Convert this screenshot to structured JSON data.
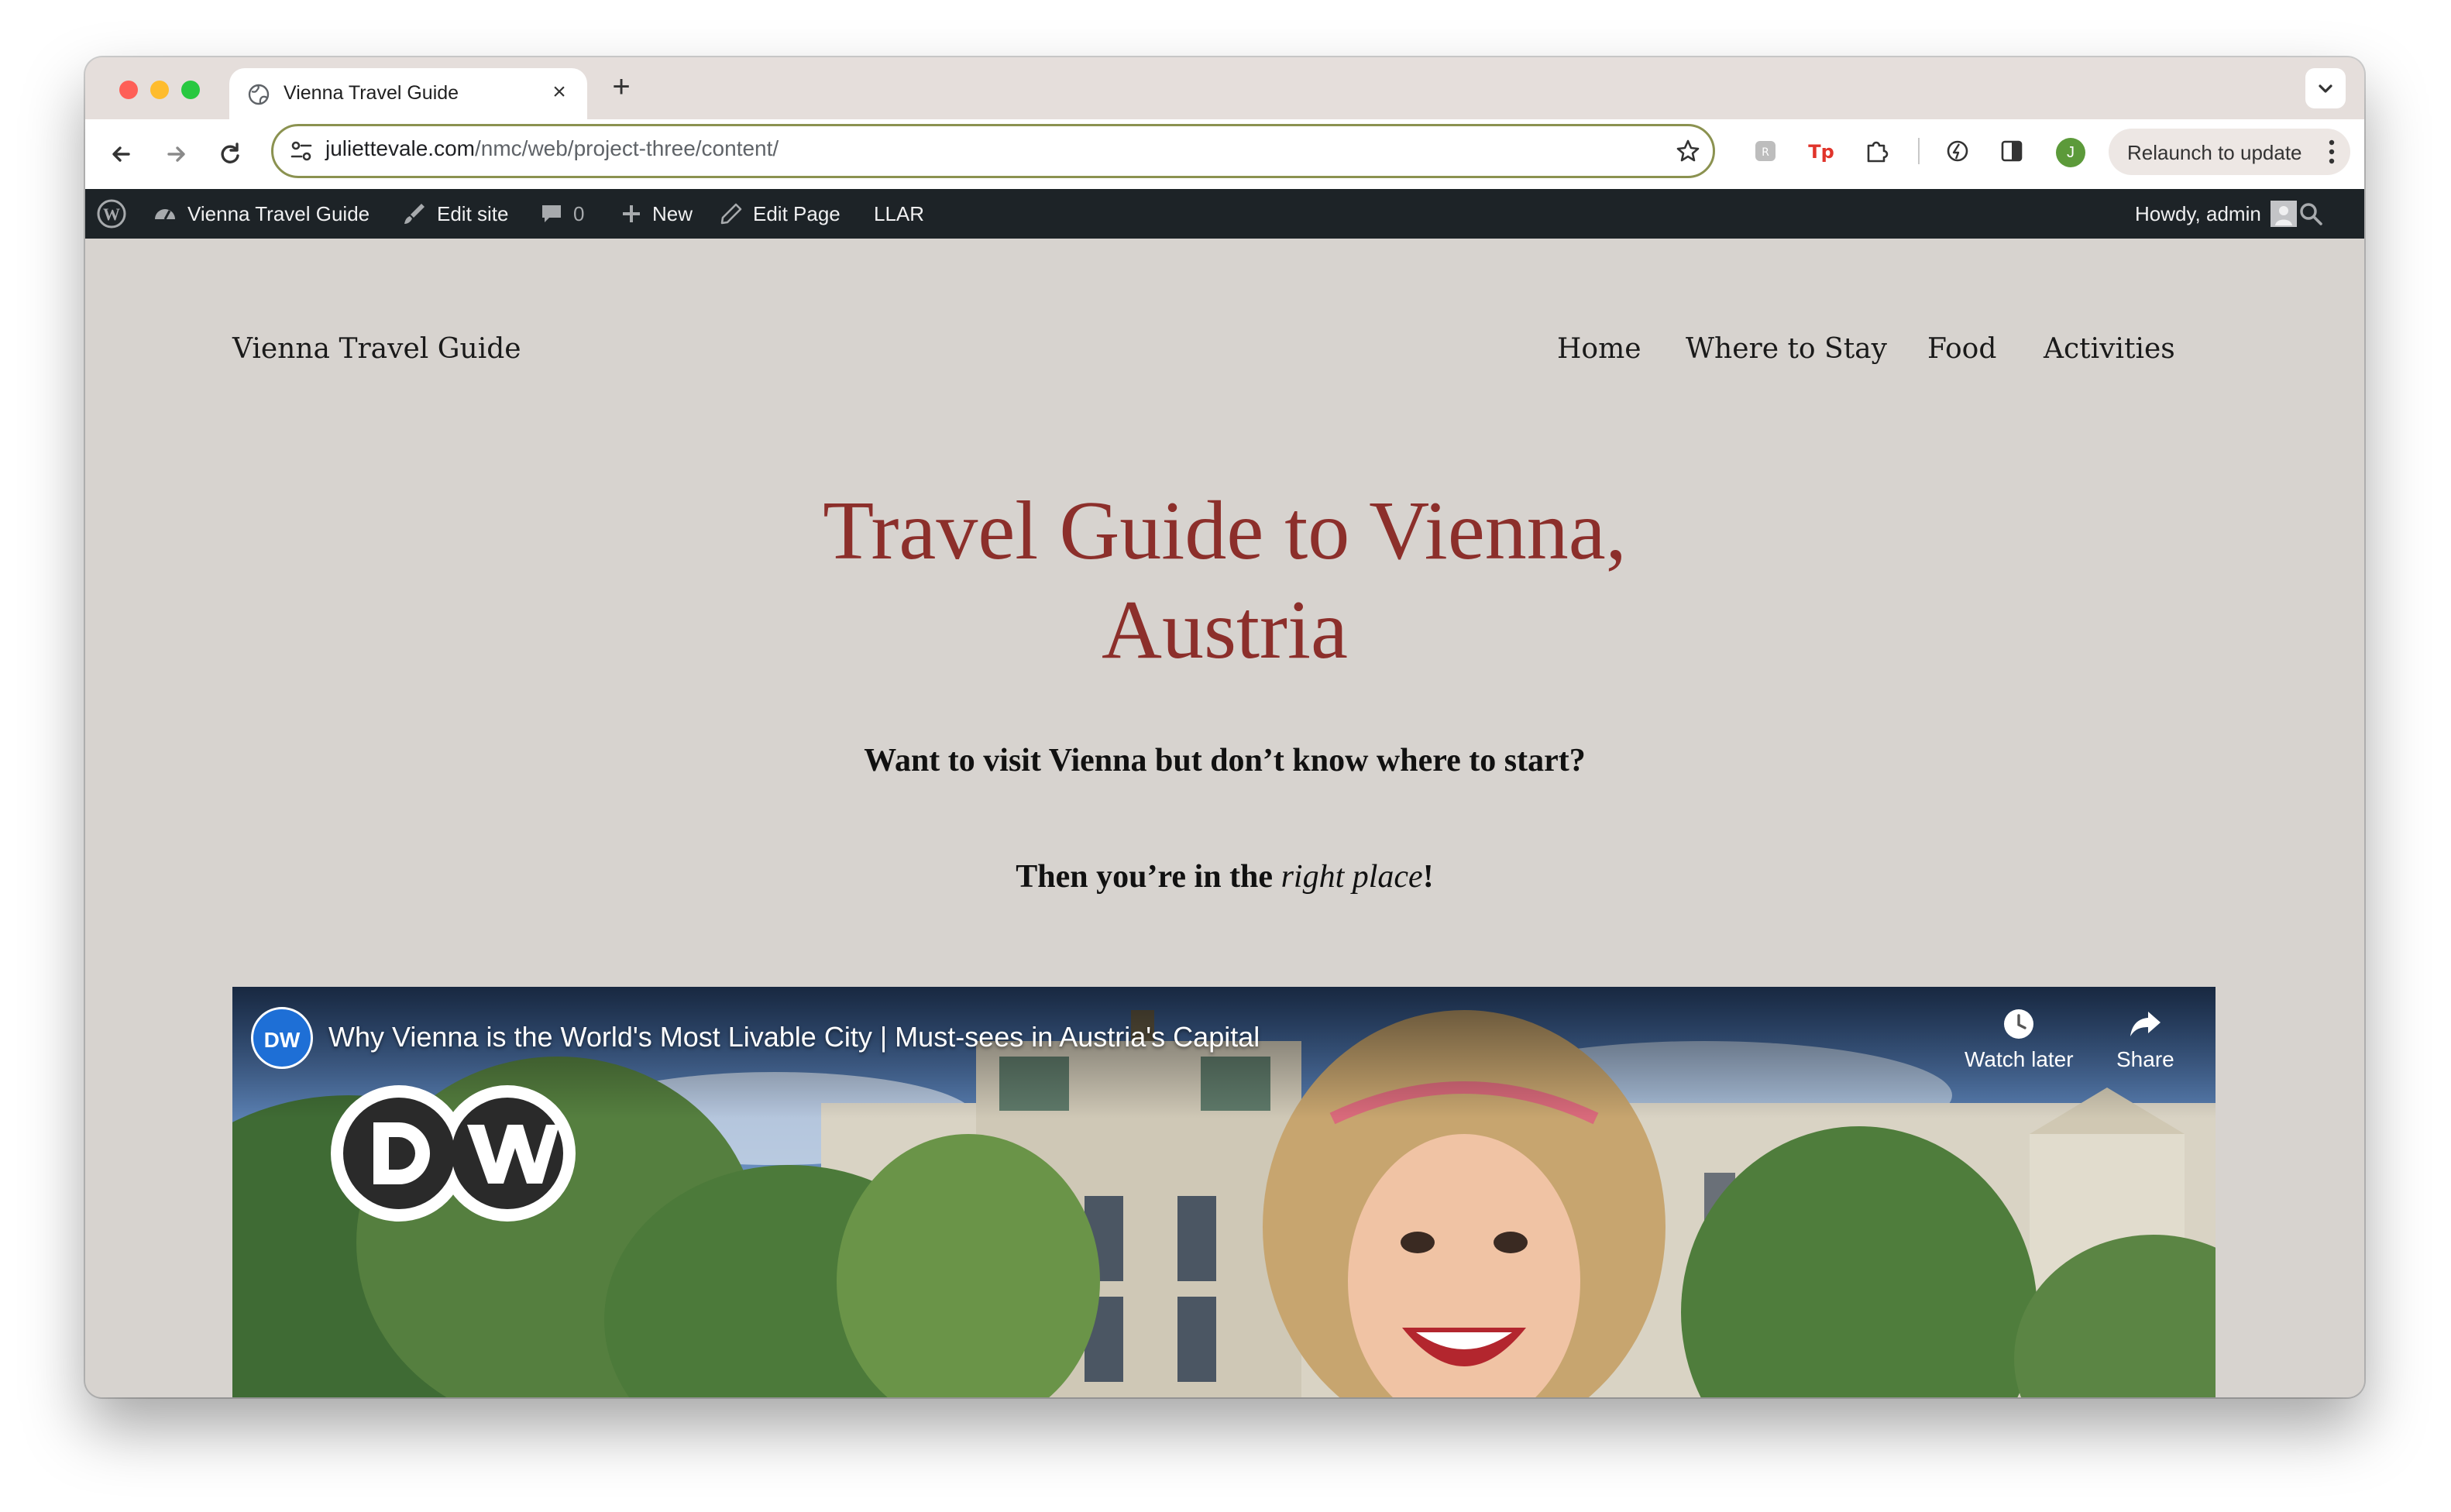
{
  "browser": {
    "tab_title": "Vienna Travel Guide",
    "new_tab_symbol": "+",
    "close_symbol": "×",
    "url_host": "juliettevale.com",
    "url_path": "/nmc/web/project-three/content/",
    "profile_initial": "J",
    "relaunch_label": "Relaunch to update"
  },
  "admin_bar": {
    "site_name": "Vienna Travel Guide",
    "edit_site": "Edit site",
    "comments_count": "0",
    "new_label": "New",
    "edit_page": "Edit Page",
    "llar": "LLAR",
    "howdy": "Howdy, admin"
  },
  "site": {
    "title": "Vienna Travel Guide",
    "nav": [
      "Home",
      "Where to Stay",
      "Food",
      "Activities"
    ],
    "hero_line1": "Travel Guide to Vienna,",
    "hero_line2": "Austria",
    "lead1": "Want to visit Vienna but don’t know where to start?",
    "lead2_a": "Then you’re in the ",
    "lead2_em": "right place",
    "lead2_b": "!"
  },
  "video": {
    "channel_badge": "DW",
    "title": "Why Vienna is the World's Most Livable City | Must-sees in Austria's Capital",
    "watch_later": "Watch later",
    "share": "Share",
    "logo_text": "DW"
  },
  "colors": {
    "accent_title": "#8c2f2b",
    "site_background": "#d7d3cf",
    "admin_bar": "#1d2327",
    "omnibox_border": "#8b9250"
  }
}
